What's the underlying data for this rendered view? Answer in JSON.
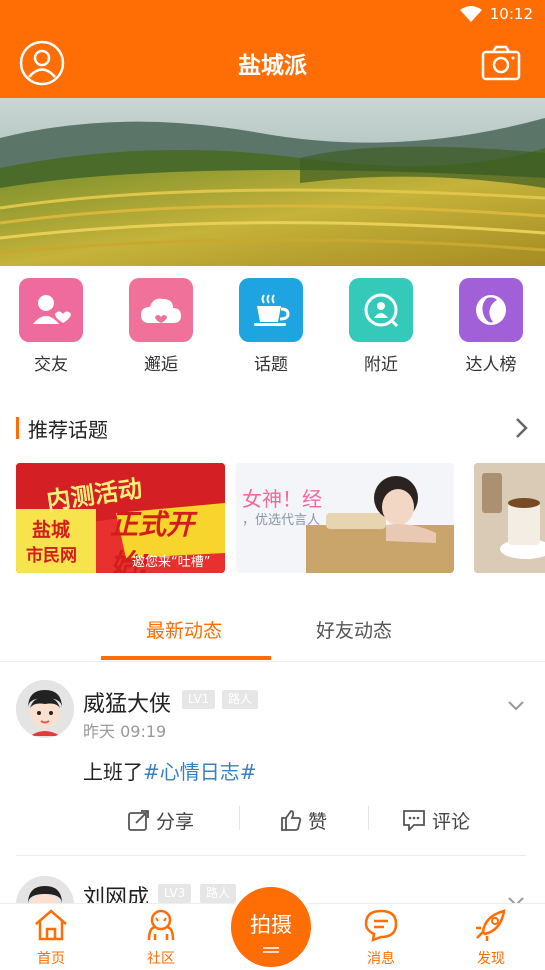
{
  "status_bar": {
    "time": "10:12"
  },
  "header": {
    "title": "盐城派",
    "left_icon": "user-icon",
    "right_icon": "camera-icon"
  },
  "quick_menu": [
    {
      "label": "交友",
      "icon": "friend-heart-icon",
      "color": "#f06b9d"
    },
    {
      "label": "邂逅",
      "icon": "cloud-heart-icon",
      "color": "#f0729a"
    },
    {
      "label": "话题",
      "icon": "coffee-cup-icon",
      "color": "#1ea4e0"
    },
    {
      "label": "附近",
      "icon": "location-icon",
      "color": "#34c9b8"
    },
    {
      "label": "达人榜",
      "icon": "portrait-icon",
      "color": "#a160d8"
    }
  ],
  "recommend": {
    "title": "推荐话题",
    "cards": [
      {
        "line1": "内测活动",
        "line2": "正式开始!",
        "brand1": "盐城",
        "brand2": "市民网",
        "sub": "邀您来“吐槽”"
      },
      {
        "line1": "女神！经",
        "sub": "，优选代言人"
      },
      {
        "line1": ""
      }
    ]
  },
  "tabs": [
    {
      "label": "最新动态",
      "active": true
    },
    {
      "label": "好友动态",
      "active": false
    }
  ],
  "posts": [
    {
      "name": "威猛大侠",
      "level": "LV1",
      "rank": "路人",
      "time": "昨天 09:19",
      "text": "上班了",
      "tag": "#心情日志#",
      "actions": {
        "share": "分享",
        "like": "赞",
        "comment": "评论"
      }
    },
    {
      "name": "刘网成",
      "level": "LV3",
      "rank": "路人"
    }
  ],
  "bottom_nav": {
    "home": "首页",
    "community": "社区",
    "shoot": "拍摄",
    "messages": "消息",
    "discover": "发现"
  },
  "colors": {
    "brand": "#ff6d05",
    "tag": "#3a7fc2"
  }
}
